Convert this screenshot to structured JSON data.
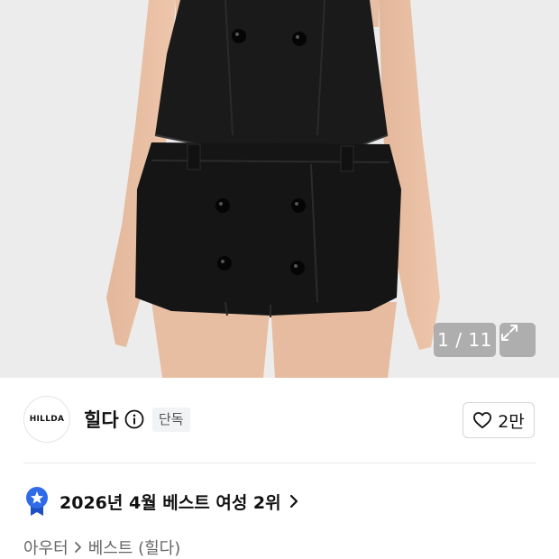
{
  "gallery": {
    "counter": "1 / 11",
    "image_alt": "black double-breasted vest and mini skirt set"
  },
  "brand": {
    "logo_text": "HILLDA",
    "name": "힐다",
    "badge": "단독",
    "likes": "2만"
  },
  "ranking": {
    "text": "2026년 4월 베스트 여성 2위"
  },
  "breadcrumb": {
    "items": [
      "아우터",
      "베스트 (힐다)"
    ]
  },
  "colors": {
    "accent_blue": "#2f6be8",
    "image_bg": "#ececed",
    "garment": "#151515"
  },
  "icons": {
    "info": "info-circle-icon",
    "heart": "heart-icon",
    "expand": "expand-arrows-icon",
    "medal": "medal-star-icon",
    "chevron": "chevron-right-icon"
  }
}
